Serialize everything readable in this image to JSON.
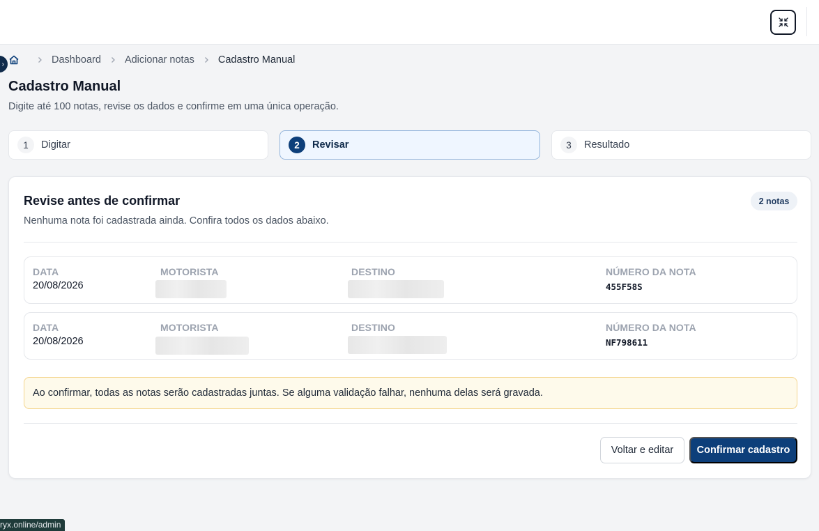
{
  "topbar": {
    "collapse_icon": "minimize-arrows-icon"
  },
  "breadcrumb": {
    "home_icon": "home-icon",
    "items": [
      "Dashboard",
      "Adicionar notas",
      "Cadastro Manual"
    ]
  },
  "page": {
    "title": "Cadastro Manual",
    "subtitle": "Digite até 100 notas, revise os dados e confirme em uma única operação."
  },
  "steps": [
    {
      "number": "1",
      "label": "Digitar",
      "active": false
    },
    {
      "number": "2",
      "label": "Revisar",
      "active": true
    },
    {
      "number": "3",
      "label": "Resultado",
      "active": false
    }
  ],
  "review": {
    "title": "Revise antes de confirmar",
    "description": "Nenhuma nota foi cadastrada ainda. Confira todos os dados abaixo.",
    "count_badge": "2 notas",
    "columns": {
      "date": "DATA",
      "driver": "MOTORISTA",
      "destination": "DESTINO",
      "note_number": "NÚMERO DA NOTA"
    },
    "rows": [
      {
        "date": "20/08/2026",
        "note_number": "455F58S"
      },
      {
        "date": "20/08/2026",
        "note_number": "NF798611"
      }
    ],
    "alert": "Ao confirmar, todas as notas serão cadastradas juntas. Se alguma validação falhar, nenhuma delas será gravada.",
    "back_button": "Voltar e editar",
    "confirm_button": "Confirmar cadastro"
  },
  "status_bar": {
    "url": "ryx.online/admin"
  },
  "colors": {
    "primary": "#0d3f7a",
    "alert_background": "#fefaeb",
    "alert_border": "#f4d58d",
    "page_background": "#f3f4f6"
  }
}
